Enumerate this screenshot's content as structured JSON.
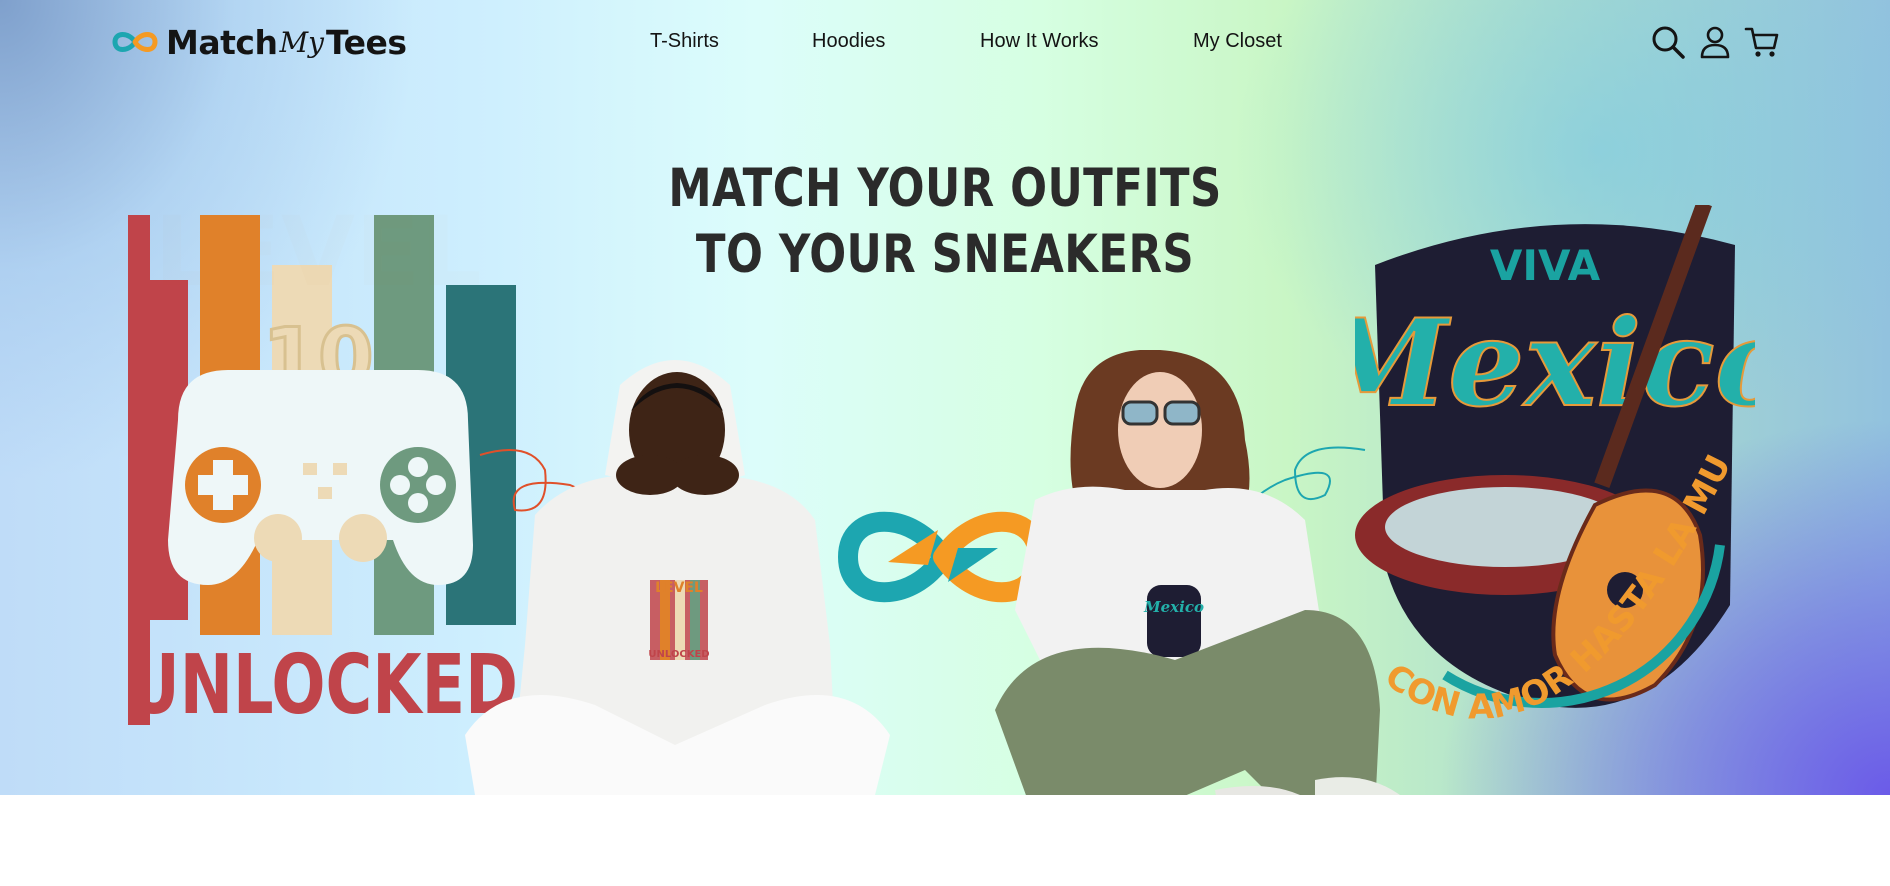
{
  "brand": {
    "part1": "Match",
    "part2": "My",
    "part3": "Tees"
  },
  "nav": [
    {
      "label": "T-Shirts"
    },
    {
      "label": "Hoodies"
    },
    {
      "label": "How It Works"
    },
    {
      "label": "My Closet"
    }
  ],
  "header_icons": [
    "search-icon",
    "account-icon",
    "cart-icon"
  ],
  "hero": {
    "headline_line1": "MATCH YOUR OUTFITS",
    "headline_line2": "TO YOUR SNEAKERS"
  },
  "graphics": {
    "level": {
      "word_top": "LEVEL",
      "number": "10",
      "word_bottom": "UNLOCKED"
    },
    "mexico": {
      "top": "VIVA",
      "script": "Mexico",
      "arc": "CON AMOR HASTA LA MUERTE"
    },
    "mini_level": {
      "word_top": "LEVEL",
      "word_bottom": "UNLOCKED"
    },
    "mini_mexico": {
      "script": "Mexico"
    }
  },
  "colors": {
    "red": "#c0444a",
    "orange": "#e0812a",
    "cream": "#eddab6",
    "sage": "#6e9a7f",
    "teal": "#2b7478",
    "link_teal": "#1da6b0",
    "link_orange": "#f59a23"
  }
}
